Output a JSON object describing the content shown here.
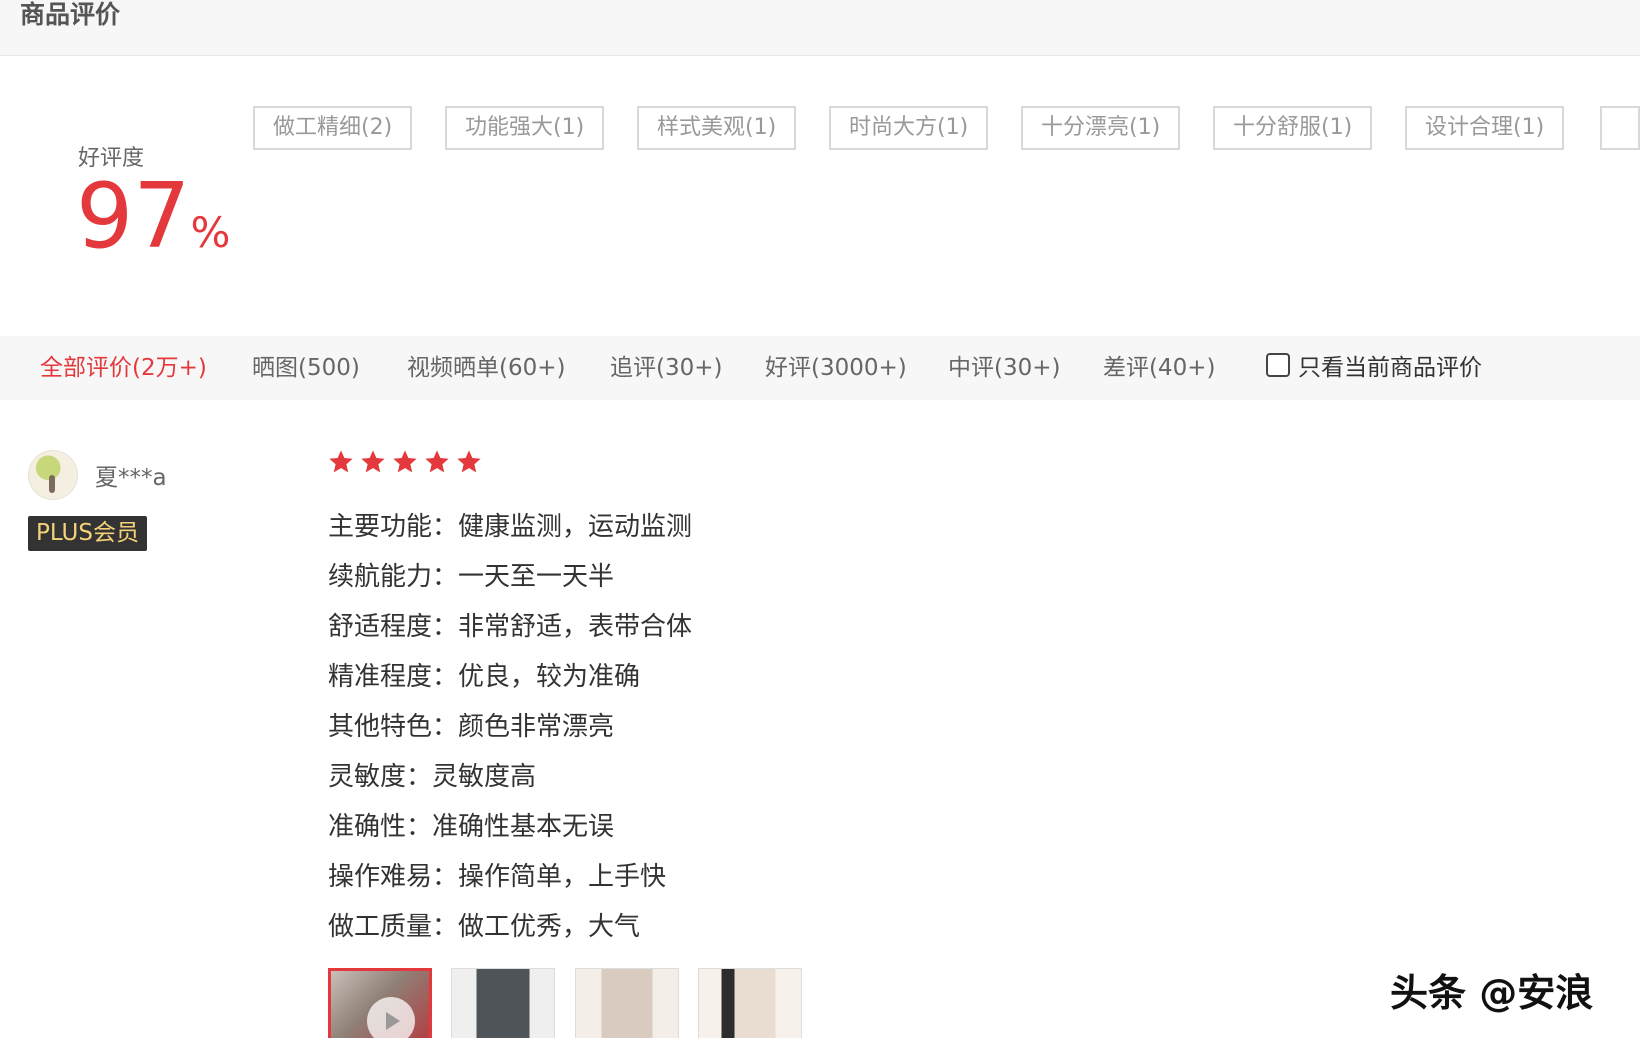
{
  "header": {
    "title": "商品评价"
  },
  "rating": {
    "label": "好评度",
    "value": "97",
    "unit": "%"
  },
  "tags": [
    "做工精细(2)",
    "功能强大(1)",
    "样式美观(1)",
    "时尚大方(1)",
    "十分漂亮(1)",
    "十分舒服(1)",
    "设计合理(1)"
  ],
  "filters": {
    "items": [
      "全部评价(2万+)",
      "晒图(500)",
      "视频晒单(60+)",
      "追评(30+)",
      "好评(3000+)",
      "中评(30+)",
      "差评(40+)"
    ],
    "active_index": 0,
    "checkbox_label": "只看当前商品评价"
  },
  "review": {
    "username": "夏***a",
    "member_badge": "PLUS会员",
    "stars": 5,
    "star_color": "#e4393c",
    "lines": [
      {
        "label": "主要功能：",
        "value": "健康监测，运动监测"
      },
      {
        "label": "续航能力：",
        "value": "一天至一天半"
      },
      {
        "label": "舒适程度：",
        "value": "非常舒适，表带合体"
      },
      {
        "label": "精准程度：",
        "value": "优良，较为准确"
      },
      {
        "label": "其他特色：",
        "value": "颜色非常漂亮"
      },
      {
        "label": "灵敏度：",
        "value": "灵敏度高"
      },
      {
        "label": "准确性：",
        "value": "准确性基本无误"
      },
      {
        "label": "操作难易：",
        "value": "操作简单，上手快"
      },
      {
        "label": "做工质量：",
        "value": "做工优秀，大气"
      }
    ]
  },
  "watermark": "头条 @安浪",
  "colors": {
    "accent": "#e4393c",
    "badge_bg": "#333333",
    "badge_text": "#f4d27a"
  }
}
